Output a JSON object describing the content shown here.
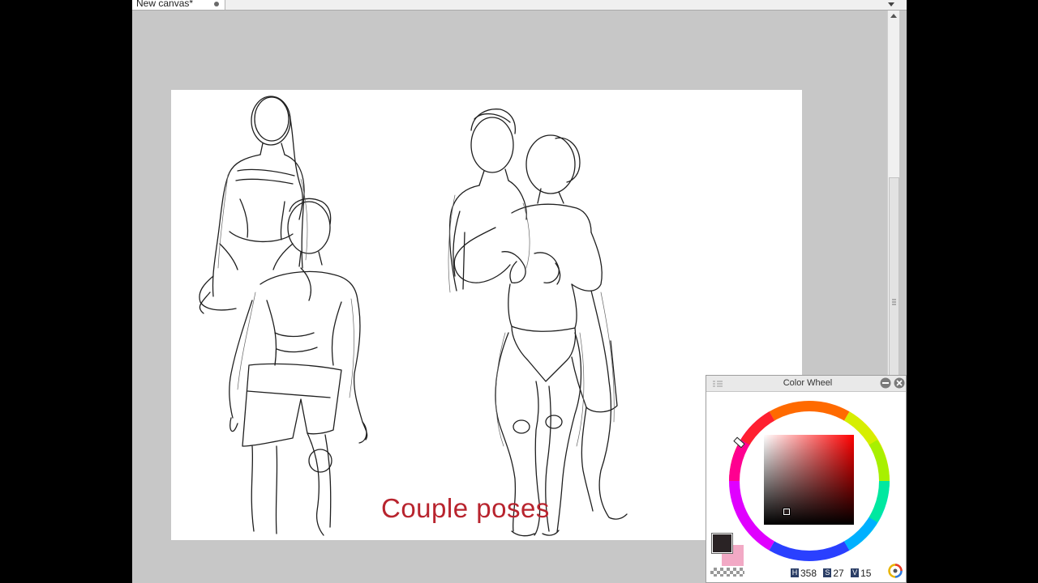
{
  "document_tab": {
    "title": "New canvas*"
  },
  "canvas": {
    "caption": "Couple poses"
  },
  "color_wheel_panel": {
    "title": "Color Wheel",
    "main_color": "#2a2325",
    "sub_color": "#f2a9c5",
    "hue_label": "H",
    "hue_value": "358",
    "saturation_label": "S",
    "saturation_value": "27",
    "value_label": "V",
    "value_value": "15"
  },
  "colors": {
    "caption_red": "#b8242e",
    "workspace_gray": "#c7c7c7"
  }
}
